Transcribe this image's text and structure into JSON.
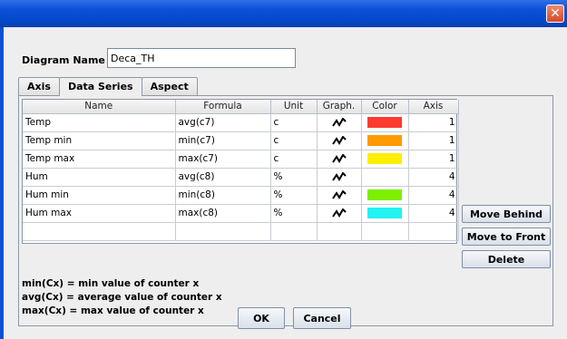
{
  "window": {
    "close_icon": "close-icon"
  },
  "diagram": {
    "label": "Diagram Name",
    "value": "Deca_TH"
  },
  "tabs": [
    {
      "label": "Axis",
      "active": false
    },
    {
      "label": "Data Series",
      "active": true
    },
    {
      "label": "Aspect",
      "active": false
    }
  ],
  "table": {
    "columns": [
      "Name",
      "Formula",
      "Unit",
      "Graph.",
      "Color",
      "Axis"
    ],
    "rows": [
      {
        "name": "Temp",
        "formula": "avg(c7)",
        "unit": "c",
        "graph": "line-graph-icon",
        "color": "#ff3b30",
        "axis": "1"
      },
      {
        "name": "Temp min",
        "formula": "min(c7)",
        "unit": "c",
        "graph": "line-graph-icon",
        "color": "#ff9a00",
        "axis": "1"
      },
      {
        "name": "Temp max",
        "formula": "max(c7)",
        "unit": "c",
        "graph": "line-graph-icon",
        "color": "#ffee00",
        "axis": "1"
      },
      {
        "name": "Hum",
        "formula": "avg(c8)",
        "unit": "%",
        "graph": "line-graph-icon",
        "color": "",
        "axis": "4"
      },
      {
        "name": "Hum min",
        "formula": "min(c8)",
        "unit": "%",
        "graph": "line-graph-icon",
        "color": "#7cf000",
        "axis": "4"
      },
      {
        "name": "Hum max",
        "formula": "max(c8)",
        "unit": "%",
        "graph": "line-graph-icon",
        "color": "#22f2f2",
        "axis": "4"
      }
    ]
  },
  "side_buttons": {
    "move_behind": "Move Behind",
    "move_front": "Move to Front",
    "delete": "Delete"
  },
  "legend": [
    "min(Cx) = min value of counter x",
    "avg(Cx) = average value of counter x",
    "max(Cx) = max value of counter x"
  ],
  "buttons": {
    "ok": "OK",
    "cancel": "Cancel"
  }
}
